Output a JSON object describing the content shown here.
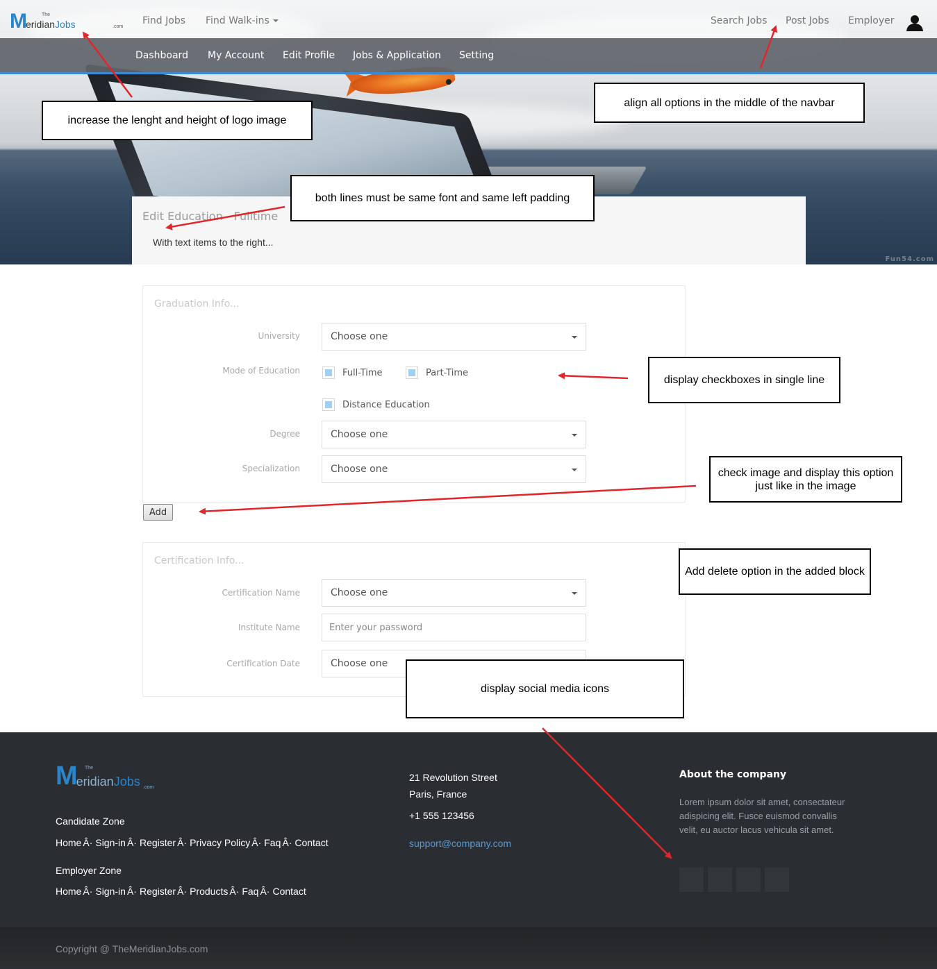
{
  "brand": {
    "logo_the": "The",
    "logo_m": "M",
    "logo_eridian": "eridian",
    "logo_jobs": "Jobs",
    "logo_com": ".com"
  },
  "topnav": {
    "find_jobs": "Find Jobs",
    "find_walkins": "Find Walk-ins",
    "search_jobs": "Search Jobs",
    "post_jobs": "Post Jobs",
    "employer": "Employer"
  },
  "subnav": [
    "Dashboard",
    "My Account",
    "Edit Profile",
    "Jobs & Application",
    "Setting"
  ],
  "hero": {
    "watermark": "Fun54.com"
  },
  "page": {
    "title": "Edit Education - Fulltime",
    "subtitle": "With text items to the right..."
  },
  "graduation": {
    "legend": "Graduation Info...",
    "university_label": "University",
    "university_value": "Choose one",
    "mode_label": "Mode of Education",
    "modes": [
      "Full-Time",
      "Part-Time",
      "Distance Education"
    ],
    "degree_label": "Degree",
    "degree_value": "Choose one",
    "specialization_label": "Specialization",
    "specialization_value": "Choose one"
  },
  "add_button": "Add",
  "certification": {
    "legend": "Certification Info...",
    "name_label": "Certification Name",
    "name_value": "Choose one",
    "institute_label": "Institute Name",
    "institute_placeholder": "Enter your password",
    "date_label": "Certification Date",
    "date_value": "Choose one"
  },
  "annotations": {
    "logo": "increase the lenght and height of logo image",
    "navbar": "align all options in the middle of the navbar",
    "title": "both lines must be same font and same left padding",
    "checkboxes": "display checkboxes in single line",
    "add": "check image and display this option just like in the image",
    "delete": "Add delete option in the added block",
    "social": "display social media icons"
  },
  "annotation_color": "#e0262b",
  "footer": {
    "candidate_zone": "Candidate Zone",
    "candidate_links": [
      "Home",
      "Sign-in",
      "Register",
      "Privacy Policy",
      "Faq",
      "Contact"
    ],
    "employer_zone": "Employer Zone",
    "employer_links": [
      "Home",
      "Sign-in",
      "Register",
      "Products",
      "Faq",
      "Contact"
    ],
    "separator": "Â·",
    "address_line1": "21 Revolution Street",
    "address_line2": "Paris, France",
    "phone": "+1 555 123456",
    "email": "support@company.com",
    "about_heading": "About the company",
    "about_text": "Lorem ipsum dolor sit amet, consectateur adispicing elit. Fusce euismod convallis velit, eu auctor lacus vehicula sit amet.",
    "copyright": "Copyright @ TheMeridianJobs.com"
  }
}
